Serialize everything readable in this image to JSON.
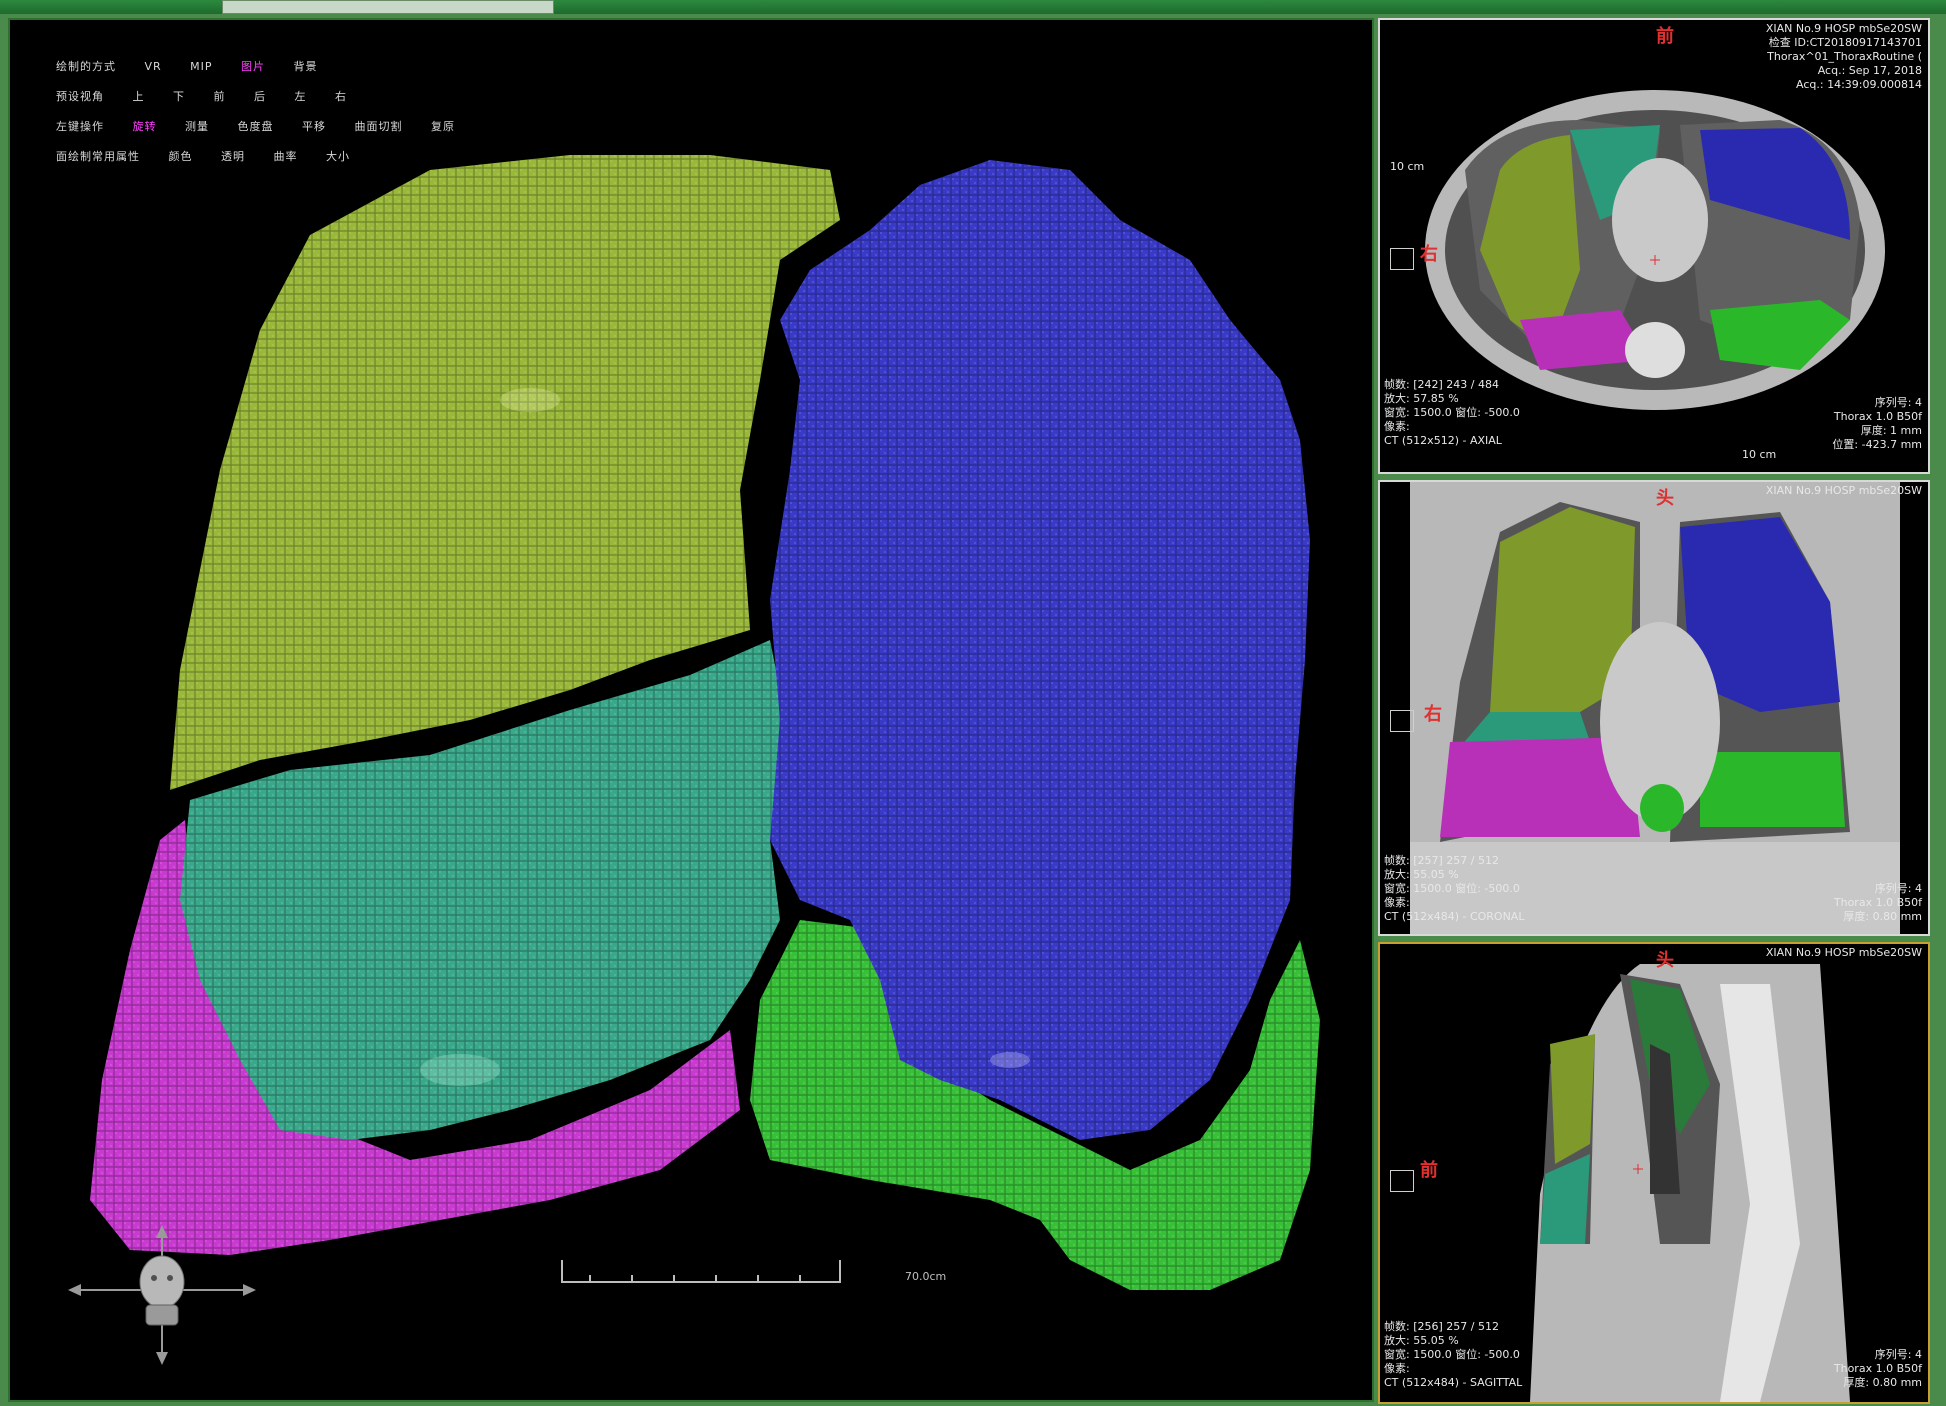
{
  "main_view": {
    "menu_rows": [
      {
        "items": [
          "绘制的方式",
          "VR",
          "MIP",
          "图片",
          "背景"
        ],
        "active": 3
      },
      {
        "items": [
          "预设视角",
          "上",
          "下",
          "前",
          "后",
          "左",
          "右"
        ],
        "active": -1
      },
      {
        "items": [
          "左键操作",
          "旋转",
          "测量",
          "色度盘",
          "平移",
          "曲面切割",
          "复原"
        ],
        "active": 1
      },
      {
        "items": [
          "面绘制常用属性",
          "颜色",
          "透明",
          "曲率",
          "大小"
        ],
        "active": -1
      }
    ],
    "scale_label": "70.0cm"
  },
  "axial": {
    "orient_top": "前",
    "orient_left": "右",
    "header": [
      "XIAN No.9 HOSP mbSe20SW",
      "检查 ID:CT20180917143701",
      "Thorax^01_ThoraxRoutine (",
      "Acq.: Sep 17, 2018",
      "Acq.: 14:39:09.000814"
    ],
    "scale_left": "10 cm",
    "scale_bottom": "10 cm",
    "footer_left": [
      "帧数: [242] 243 / 484",
      "放大: 57.85 %",
      "窗宽: 1500.0 窗位: -500.0",
      "像素:",
      "CT (512x512) - AXIAL"
    ],
    "footer_right": [
      "序列号: 4",
      "Thorax 1.0 B50f",
      "厚度: 1 mm",
      "位置: -423.7 mm"
    ]
  },
  "coronal": {
    "orient_top": "头",
    "orient_left": "右",
    "header": [
      "XIAN No.9 HOSP mbSe20SW"
    ],
    "footer_left": [
      "帧数: [257] 257 / 512",
      "放大: 55.05 %",
      "窗宽: 1500.0 窗位: -500.0",
      "像素:",
      "CT (512x484) - CORONAL"
    ],
    "footer_right": [
      "序列号: 4",
      "Thorax 1.0 B50f",
      "厚度: 0.80 mm"
    ]
  },
  "sagittal": {
    "orient_top": "头",
    "orient_left": "前",
    "header": [
      "XIAN No.9 HOSP mbSe20SW"
    ],
    "footer_left": [
      "帧数: [256] 257 / 512",
      "放大: 55.05 %",
      "窗宽: 1500.0 窗位: -500.0",
      "像素:",
      "CT (512x484) - SAGITTAL"
    ],
    "footer_right": [
      "序列号: 4",
      "Thorax 1.0 B50f",
      "厚度: 0.80 mm"
    ]
  },
  "colors": {
    "right_upper": "#9ab83a",
    "right_middle": "#3aa88a",
    "right_lower": "#c83ad0",
    "left_upper": "#3a3ac8",
    "left_lower": "#38c038",
    "lung_bg": "#606060",
    "tissue": "#bdbdbd"
  }
}
